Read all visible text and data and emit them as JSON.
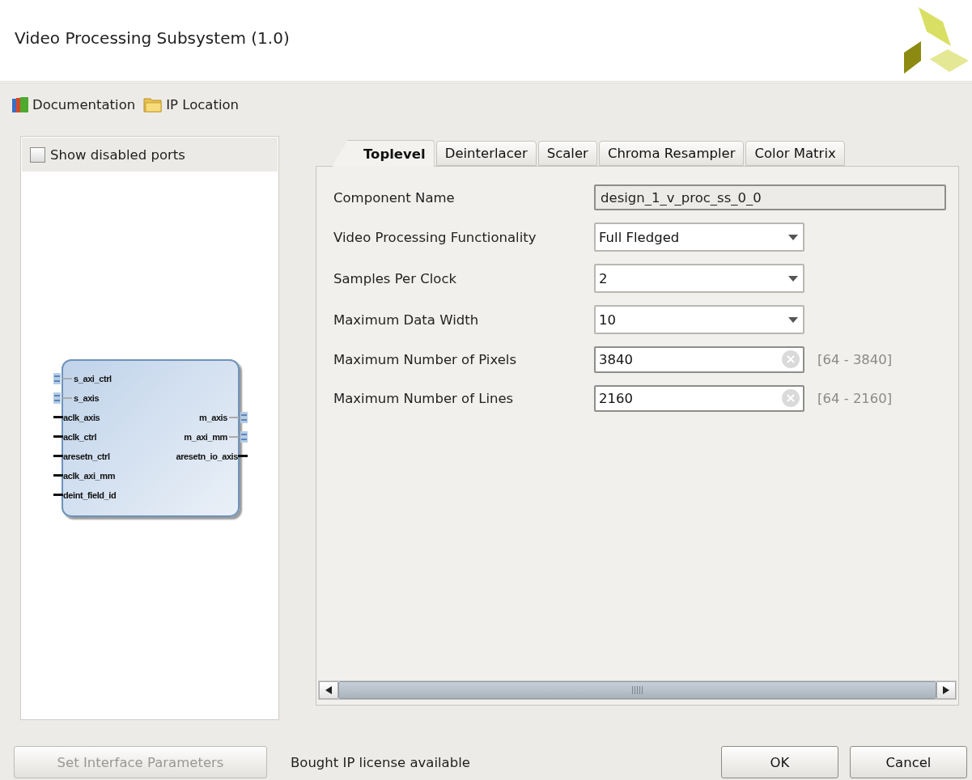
{
  "window": {
    "title": "Video Processing Subsystem (1.0)"
  },
  "toolbar": [
    {
      "kind": "books",
      "label": "Documentation"
    },
    {
      "kind": "folder",
      "label": "IP Location"
    }
  ],
  "symbol_panel": {
    "show_disabled_ports": {
      "label": "Show disabled ports",
      "checked": false
    },
    "block": {
      "left_ports": [
        {
          "name": "s_axi_ctrl",
          "kind": "bus"
        },
        {
          "name": "s_axis",
          "kind": "bus"
        },
        {
          "name": "aclk_axis",
          "kind": "wire"
        },
        {
          "name": "aclk_ctrl",
          "kind": "wire"
        },
        {
          "name": "aresetn_ctrl",
          "kind": "wire"
        },
        {
          "name": "aclk_axi_mm",
          "kind": "wire"
        },
        {
          "name": "deint_field_id",
          "kind": "wire"
        }
      ],
      "right_ports": [
        {
          "name": "m_axis",
          "kind": "bus"
        },
        {
          "name": "m_axi_mm",
          "kind": "bus"
        },
        {
          "name": "aresetn_io_axis",
          "kind": "wire"
        }
      ]
    }
  },
  "tabs": [
    {
      "label": "Toplevel",
      "selected": true
    },
    {
      "label": "Deinterlacer",
      "selected": false
    },
    {
      "label": "Scaler",
      "selected": false
    },
    {
      "label": "Chroma Resampler",
      "selected": false
    },
    {
      "label": "Color Matrix",
      "selected": false
    }
  ],
  "fields": [
    {
      "kind": "name",
      "label": "Component Name",
      "value": "design_1_v_proc_ss_0_0"
    },
    {
      "kind": "dropdown",
      "label": "Video Processing Functionality",
      "value": "Full Fledged"
    },
    {
      "kind": "dropdown",
      "label": "Samples Per Clock",
      "value": "2"
    },
    {
      "kind": "dropdown",
      "label": "Maximum Data Width",
      "value": "10"
    },
    {
      "kind": "number",
      "label": "Maximum Number of Pixels",
      "value": "3840",
      "range": "[64 - 3840]"
    },
    {
      "kind": "number",
      "label": "Maximum Number of Lines",
      "value": "2160",
      "range": "[64 - 2160]"
    }
  ],
  "footer": {
    "interface_button": {
      "label": "Set Interface Parameters",
      "disabled": true
    },
    "status": "Bought IP license available",
    "buttons": [
      "OK",
      "Cancel"
    ]
  }
}
